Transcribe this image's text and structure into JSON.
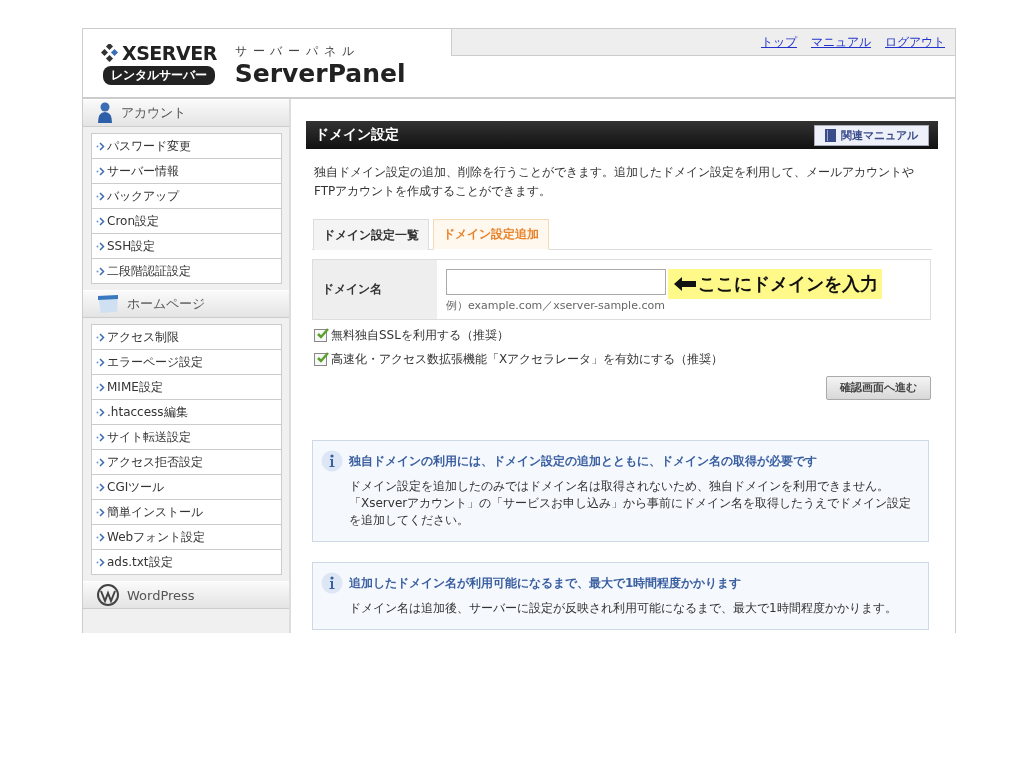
{
  "header": {
    "brand": "XSERVER",
    "badge": "レンタルサーバー",
    "kana": "サ ー バ ー パ ネ ル",
    "title": "ServerPanel",
    "links": [
      "トップ",
      "マニュアル",
      "ログアウト"
    ]
  },
  "sidebar": {
    "sections": [
      {
        "kind": "account",
        "title": "アカウント",
        "items": [
          "パスワード変更",
          "サーバー情報",
          "バックアップ",
          "Cron設定",
          "SSH設定",
          "二段階認証設定"
        ]
      },
      {
        "kind": "homepage",
        "title": "ホームページ",
        "items": [
          "アクセス制限",
          "エラーページ設定",
          "MIME設定",
          ".htaccess編集",
          "サイト転送設定",
          "アクセス拒否設定",
          "CGIツール",
          "簡単インストール",
          "Webフォント設定",
          "ads.txt設定"
        ]
      },
      {
        "kind": "wordpress",
        "title": "WordPress"
      }
    ]
  },
  "main": {
    "title": "ドメイン設定",
    "manual_button": "関連マニュアル",
    "description": "独自ドメイン設定の追加、削除を行うことができます。追加したドメイン設定を利用して、メールアカウントやFTPアカウントを作成することができます。",
    "tabs": [
      {
        "label": "ドメイン設定一覧",
        "selected": false
      },
      {
        "label": "ドメイン設定追加",
        "selected": true
      }
    ],
    "form": {
      "label": "ドメイン名",
      "hint": "例）example.com／xserver-sample.com",
      "callout": "ここにドメインを入力"
    },
    "checkboxes": [
      {
        "label": "無料独自SSLを利用する（推奨）",
        "checked": true
      },
      {
        "label": "高速化・アクセス数拡張機能「Xアクセラレータ」を有効にする（推奨）",
        "checked": true
      }
    ],
    "submit_button": "確認画面へ進む",
    "notices": [
      {
        "title": "独自ドメインの利用には、ドメイン設定の追加とともに、ドメイン名の取得が必要です",
        "body": "ドメイン設定を追加したのみではドメイン名は取得されないため、独自ドメインを利用できません。「Xserverアカウント」の「サービスお申し込み」から事前にドメイン名を取得したうえでドメイン設定を追加してください。"
      },
      {
        "title": "追加したドメイン名が利用可能になるまで、最大で1時間程度かかります",
        "body": "ドメイン名は追加後、サーバーに設定が反映され利用可能になるまで、最大で1時間程度かかります。"
      }
    ]
  }
}
